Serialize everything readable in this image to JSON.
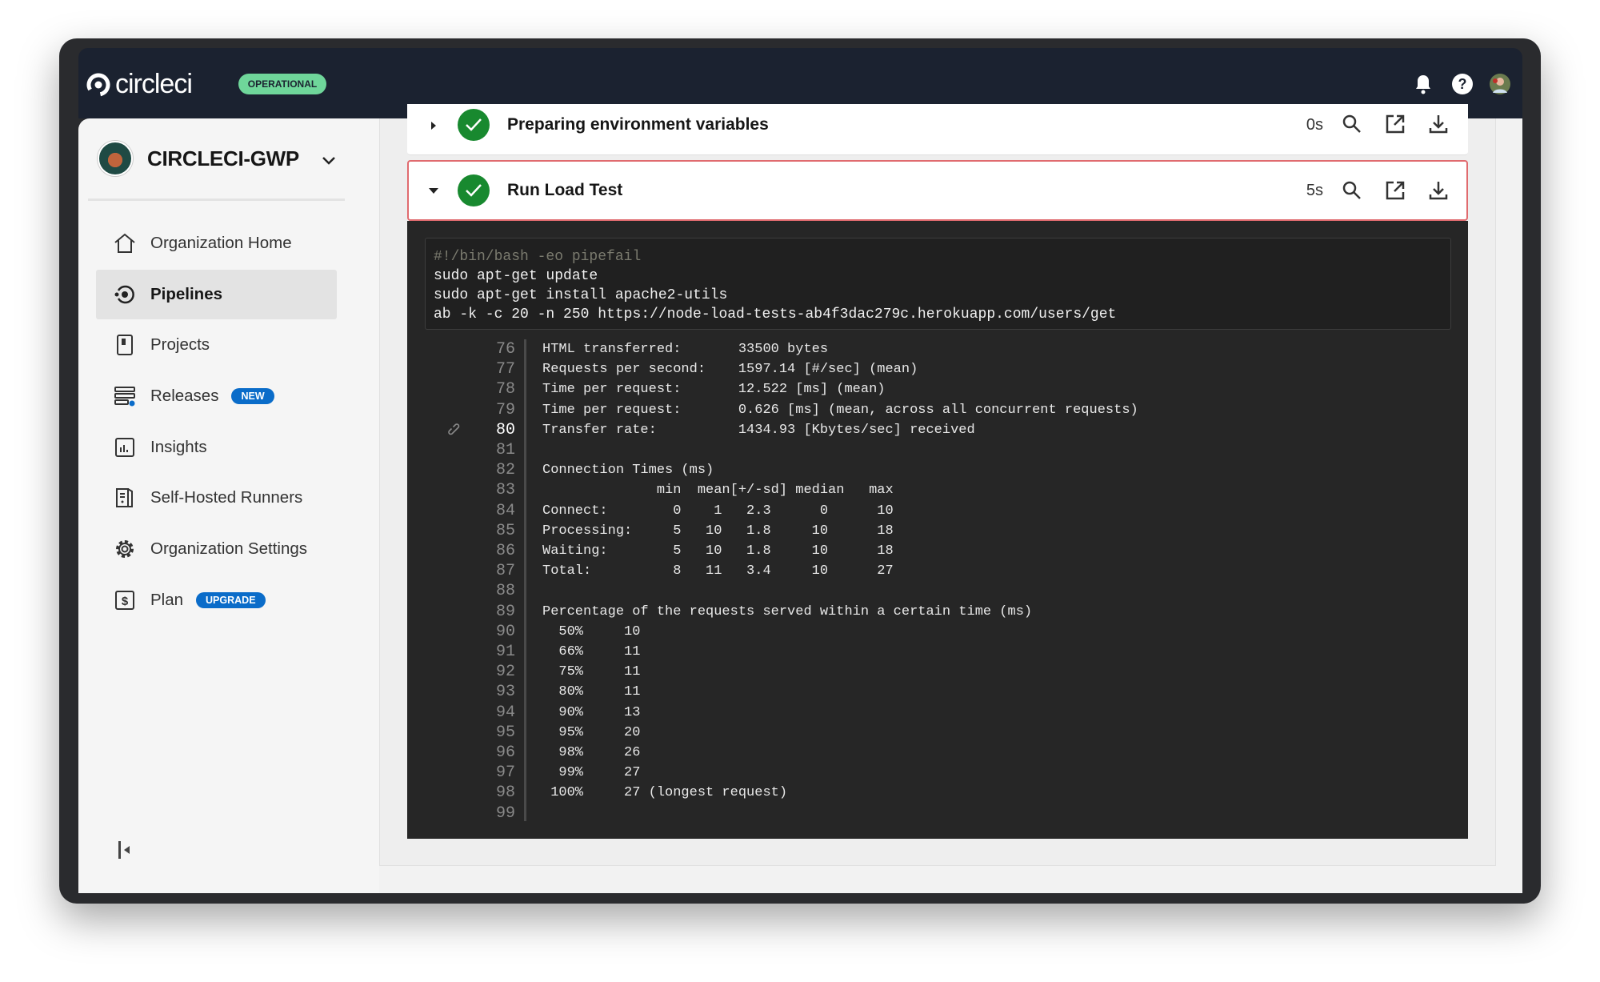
{
  "header": {
    "logo_text": "circleci",
    "status_badge": "OPERATIONAL",
    "icons": [
      "bell-icon",
      "help-icon",
      "user-avatar"
    ]
  },
  "sidebar": {
    "org_name": "CIRCLECI-GWP",
    "items": [
      {
        "label": "Organization Home",
        "icon": "home-icon"
      },
      {
        "label": "Pipelines",
        "icon": "pipelines-icon",
        "active": true
      },
      {
        "label": "Projects",
        "icon": "projects-icon"
      },
      {
        "label": "Releases",
        "icon": "releases-icon",
        "badge": "NEW"
      },
      {
        "label": "Insights",
        "icon": "insights-icon"
      },
      {
        "label": "Self-Hosted Runners",
        "icon": "runners-icon"
      },
      {
        "label": "Organization Settings",
        "icon": "gear-icon"
      },
      {
        "label": "Plan",
        "icon": "dollar-icon",
        "badge": "UPGRADE"
      }
    ]
  },
  "steps": [
    {
      "title": "Preparing environment variables",
      "duration": "0s",
      "status": "success",
      "expanded": false
    },
    {
      "title": "Run Load Test",
      "duration": "5s",
      "status": "success",
      "expanded": true
    }
  ],
  "command": {
    "lines": [
      "#!/bin/bash -eo pipefail",
      "sudo apt-get update",
      "sudo apt-get install apache2-utils",
      "ab -k -c 20 -n 250 https://node-load-tests-ab4f3dac279c.herokuapp.com/users/get"
    ]
  },
  "log": {
    "current_line": "80",
    "lines": [
      {
        "n": "76",
        "t": "HTML transferred:       33500 bytes"
      },
      {
        "n": "77",
        "t": "Requests per second:    1597.14 [#/sec] (mean)"
      },
      {
        "n": "78",
        "t": "Time per request:       12.522 [ms] (mean)"
      },
      {
        "n": "79",
        "t": "Time per request:       0.626 [ms] (mean, across all concurrent requests)"
      },
      {
        "n": "80",
        "t": "Transfer rate:          1434.93 [Kbytes/sec] received"
      },
      {
        "n": "81",
        "t": ""
      },
      {
        "n": "82",
        "t": "Connection Times (ms)"
      },
      {
        "n": "83",
        "t": "              min  mean[+/-sd] median   max"
      },
      {
        "n": "84",
        "t": "Connect:        0    1   2.3      0      10"
      },
      {
        "n": "85",
        "t": "Processing:     5   10   1.8     10      18"
      },
      {
        "n": "86",
        "t": "Waiting:        5   10   1.8     10      18"
      },
      {
        "n": "87",
        "t": "Total:          8   11   3.4     10      27"
      },
      {
        "n": "88",
        "t": ""
      },
      {
        "n": "89",
        "t": "Percentage of the requests served within a certain time (ms)"
      },
      {
        "n": "90",
        "t": "  50%     10"
      },
      {
        "n": "91",
        "t": "  66%     11"
      },
      {
        "n": "92",
        "t": "  75%     11"
      },
      {
        "n": "93",
        "t": "  80%     11"
      },
      {
        "n": "94",
        "t": "  90%     13"
      },
      {
        "n": "95",
        "t": "  95%     20"
      },
      {
        "n": "96",
        "t": "  98%     26"
      },
      {
        "n": "97",
        "t": "  99%     27"
      },
      {
        "n": "98",
        "t": " 100%     27 (longest request)"
      },
      {
        "n": "99",
        "t": ""
      }
    ]
  },
  "colors": {
    "header_bg": "#1b2230",
    "operational": "#6fd69a",
    "badge_blue": "#0a6cc9",
    "success": "#18892f",
    "active_step_border": "#e06b6f"
  }
}
